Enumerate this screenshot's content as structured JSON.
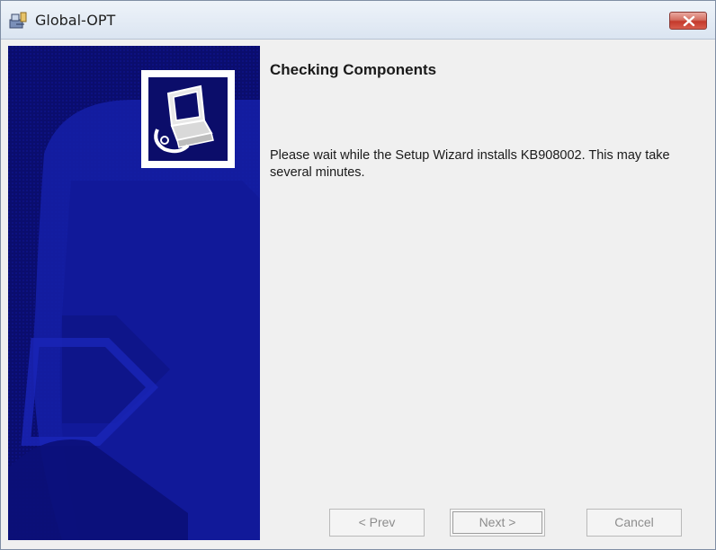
{
  "window": {
    "title": "Global-OPT",
    "title_icon": "installer-icon",
    "close_icon": "close-icon"
  },
  "side_panel": {
    "background_color": "#0a0d6e",
    "logo_icon": "computer-install-icon"
  },
  "main": {
    "heading": "Checking Components",
    "message": "Please wait while the Setup Wizard installs KB908002.  This may take several minutes."
  },
  "buttons": {
    "prev_label": "< Prev",
    "next_label": "Next >",
    "cancel_label": "Cancel",
    "enabled": false
  }
}
